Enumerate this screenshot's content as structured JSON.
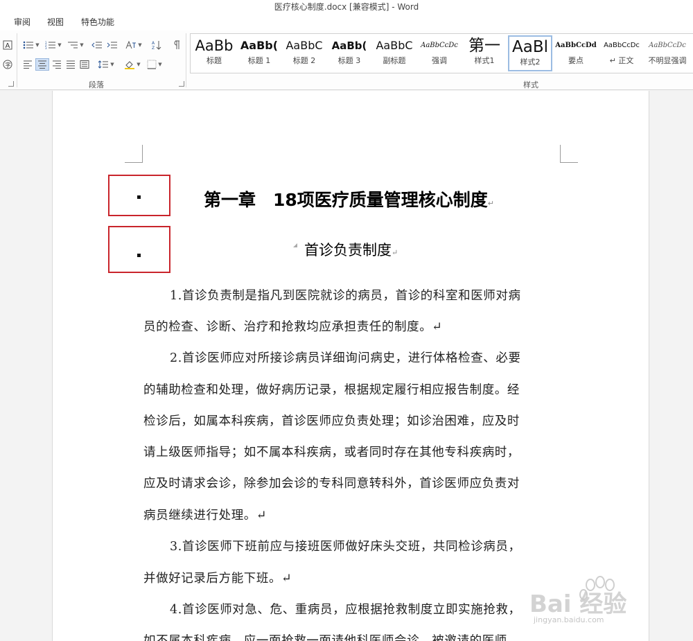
{
  "window": {
    "title": "医疗核心制度.docx [兼容模式] - Word"
  },
  "tabs": [
    "审阅",
    "视图",
    "特色功能"
  ],
  "ribbon": {
    "paragraph_group_label": "段落",
    "styles_group_label": "样式",
    "styles": [
      {
        "preview": "AaBb",
        "name": "标题"
      },
      {
        "preview": "AaBb(",
        "name": "标题 1"
      },
      {
        "preview": "AaBbC",
        "name": "标题 2"
      },
      {
        "preview": "AaBb(",
        "name": "标题 3"
      },
      {
        "preview": "AaBbC",
        "name": "副标题"
      },
      {
        "preview": "AaBbCcDc",
        "name": "强调"
      },
      {
        "preview": "第一",
        "name": "样式1"
      },
      {
        "preview": "AaBl",
        "name": "样式2"
      },
      {
        "preview": "AaBbCcDd",
        "name": "要点"
      },
      {
        "preview": "AaBbCcDc",
        "name": "↵ 正文"
      },
      {
        "preview": "AaBbCcDc",
        "name": "不明显强调"
      }
    ],
    "selected_style": "样式2"
  },
  "document": {
    "chapter_title": "第一章　18项医疗质量管理核心制度",
    "section_title": "首诊负责制度",
    "paragraph_mark": "↵",
    "lines": [
      "1.首诊负责制是指凡到医院就诊的病员，首诊的科室和医师对病",
      "员的检查、诊断、治疗和抢救均应承担责任的制度。↵",
      "2.首诊医师应对所接诊病员详细询问病史，进行体格检查、必要",
      "的辅助检查和处理，做好病历记录，根据规定履行相应报告制度。经",
      "检诊后，如属本科疾病，首诊医师应负责处理；如诊治困难，应及时",
      "请上级医师指导；如不属本科疾病，或者同时存在其他专科疾病时，",
      "应及时请求会诊，除参加会诊的专科同意转科外，首诊医师应负责对",
      "病员继续进行处理。↵",
      "3.首诊医师下班前应与接班医师做好床头交班，共同检诊病员，",
      "并做好记录后方能下班。↵",
      "4.首诊医师对急、危、重病员，应根据抢救制度立即实施抢救，",
      "如不属本科疾病，应一面抢救一面请他科医师会诊，被邀请的医师"
    ]
  },
  "watermark": {
    "brand": "Bai 经验",
    "url": "jingyan.baidu.com"
  },
  "colors": {
    "highlight_box": "#c9242b",
    "selected_style_border": "#9bbce2"
  }
}
